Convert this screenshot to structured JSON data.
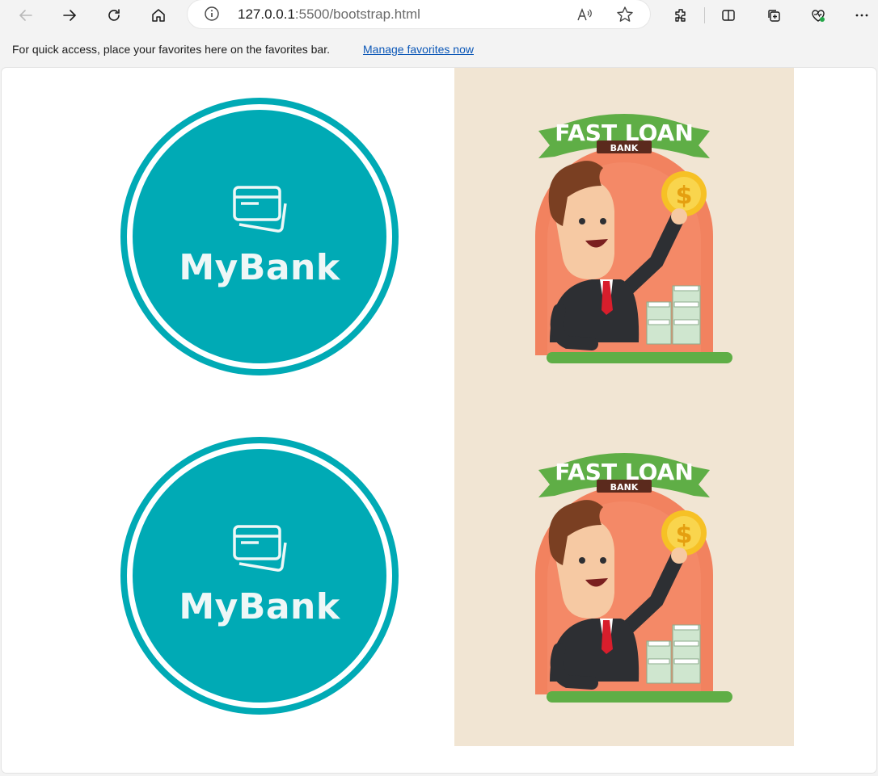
{
  "browser": {
    "url_host": "127.0.0.1",
    "url_rest": ":5500/bootstrap.html",
    "toolbar_icons": [
      "back-icon",
      "forward-icon",
      "refresh-icon",
      "home-icon",
      "site-info-icon",
      "read-aloud-icon",
      "favorite-star-icon",
      "extensions-icon",
      "split-screen-icon",
      "collections-icon",
      "browser-essentials-icon",
      "more-menu-icon"
    ]
  },
  "favorites_bar": {
    "message": "For quick access, place your favorites here on the favorites bar.",
    "link": "Manage favorites now"
  },
  "content": {
    "logos": [
      {
        "brand": "MyBank",
        "icon": "credit-card-icon"
      },
      {
        "brand": "MyBank",
        "icon": "credit-card-icon"
      }
    ],
    "ads": [
      {
        "banner_title": "FAST LOAN",
        "banner_sub": "BANK"
      },
      {
        "banner_title": "FAST LOAN",
        "banner_sub": "BANK"
      }
    ]
  },
  "colors": {
    "brand_teal": "#00aab5",
    "ad_background": "#f1e5d3",
    "banner_green": "#5fae46",
    "arch_orange": "#f2825f",
    "link_blue": "#0b57b7"
  }
}
